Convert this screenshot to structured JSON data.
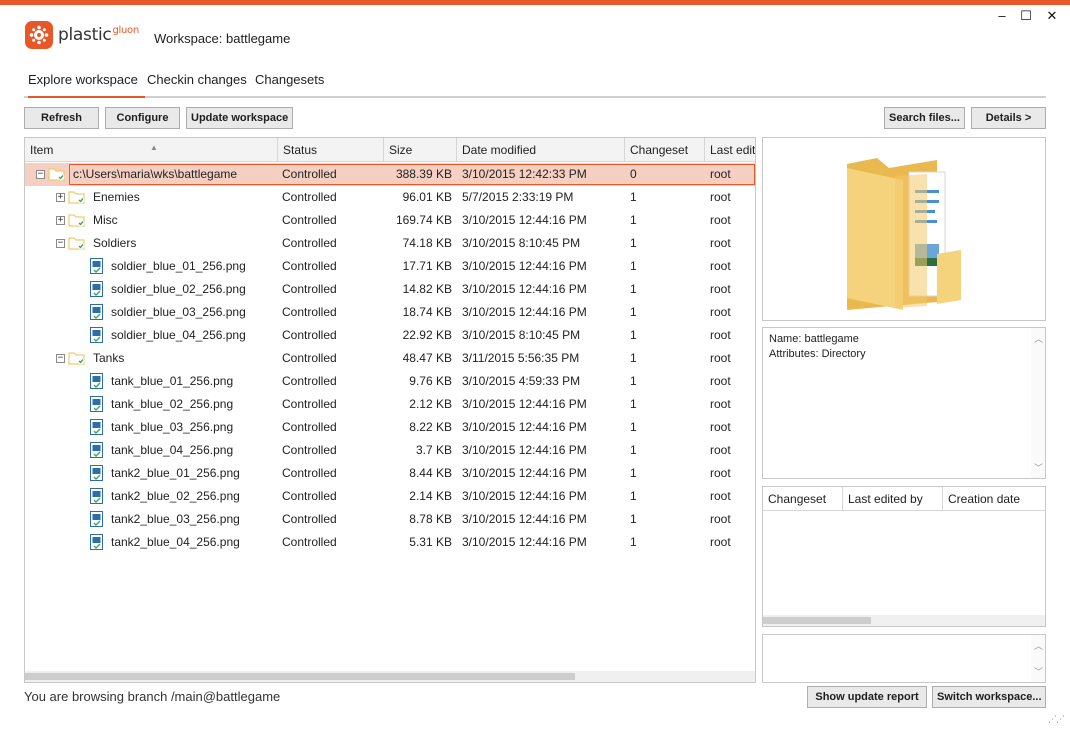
{
  "window": {
    "minimize": "–",
    "maximize": "☐",
    "close": "✕"
  },
  "logo": {
    "name": "plastic",
    "sup": "gluon"
  },
  "header": {
    "title": "Workspace: battlegame"
  },
  "tabs": [
    {
      "label": "Explore workspace",
      "active": true
    },
    {
      "label": "Checkin changes",
      "active": false
    },
    {
      "label": "Changesets",
      "active": false
    }
  ],
  "toolbar": {
    "refresh": "Refresh",
    "configure": "Configure",
    "update_workspace": "Update workspace",
    "search_files": "Search files...",
    "details": "Details >"
  },
  "columns": {
    "item": "Item",
    "status": "Status",
    "size": "Size",
    "date_modified": "Date modified",
    "changeset": "Changeset",
    "last_edit": "Last edit"
  },
  "rows": [
    {
      "name": "c:\\Users\\maria\\wks\\battlegame",
      "type": "folder",
      "level": 0,
      "expander": "−",
      "status": "Controlled",
      "size": "388.39 KB",
      "date": "3/10/2015 12:42:33 PM",
      "changeset": "0",
      "last": "root"
    },
    {
      "name": "Enemies",
      "type": "folder",
      "level": 1,
      "expander": "+",
      "status": "Controlled",
      "size": "96.01 KB",
      "date": "5/7/2015 2:33:19 PM",
      "changeset": "1",
      "last": "root"
    },
    {
      "name": "Misc",
      "type": "folder",
      "level": 1,
      "expander": "+",
      "status": "Controlled",
      "size": "169.74 KB",
      "date": "3/10/2015 12:44:16 PM",
      "changeset": "1",
      "last": "root"
    },
    {
      "name": "Soldiers",
      "type": "folder",
      "level": 1,
      "expander": "−",
      "status": "Controlled",
      "size": "74.18 KB",
      "date": "3/10/2015 8:10:45 PM",
      "changeset": "1",
      "last": "root"
    },
    {
      "name": "soldier_blue_01_256.png",
      "type": "file",
      "level": 2,
      "status": "Controlled",
      "size": "17.71 KB",
      "date": "3/10/2015 12:44:16 PM",
      "changeset": "1",
      "last": "root"
    },
    {
      "name": "soldier_blue_02_256.png",
      "type": "file",
      "level": 2,
      "status": "Controlled",
      "size": "14.82 KB",
      "date": "3/10/2015 12:44:16 PM",
      "changeset": "1",
      "last": "root"
    },
    {
      "name": "soldier_blue_03_256.png",
      "type": "file",
      "level": 2,
      "status": "Controlled",
      "size": "18.74 KB",
      "date": "3/10/2015 12:44:16 PM",
      "changeset": "1",
      "last": "root"
    },
    {
      "name": "soldier_blue_04_256.png",
      "type": "file",
      "level": 2,
      "status": "Controlled",
      "size": "22.92 KB",
      "date": "3/10/2015 8:10:45 PM",
      "changeset": "1",
      "last": "root"
    },
    {
      "name": "Tanks",
      "type": "folder",
      "level": 1,
      "expander": "−",
      "status": "Controlled",
      "size": "48.47 KB",
      "date": "3/11/2015 5:56:35 PM",
      "changeset": "1",
      "last": "root"
    },
    {
      "name": "tank_blue_01_256.png",
      "type": "file",
      "level": 2,
      "status": "Controlled",
      "size": "9.76 KB",
      "date": "3/10/2015 4:59:33 PM",
      "changeset": "1",
      "last": "root"
    },
    {
      "name": "tank_blue_02_256.png",
      "type": "file",
      "level": 2,
      "status": "Controlled",
      "size": "2.12 KB",
      "date": "3/10/2015 12:44:16 PM",
      "changeset": "1",
      "last": "root"
    },
    {
      "name": "tank_blue_03_256.png",
      "type": "file",
      "level": 2,
      "status": "Controlled",
      "size": "8.22 KB",
      "date": "3/10/2015 12:44:16 PM",
      "changeset": "1",
      "last": "root"
    },
    {
      "name": "tank_blue_04_256.png",
      "type": "file",
      "level": 2,
      "status": "Controlled",
      "size": "3.7 KB",
      "date": "3/10/2015 12:44:16 PM",
      "changeset": "1",
      "last": "root"
    },
    {
      "name": "tank2_blue_01_256.png",
      "type": "file",
      "level": 2,
      "status": "Controlled",
      "size": "8.44 KB",
      "date": "3/10/2015 12:44:16 PM",
      "changeset": "1",
      "last": "root"
    },
    {
      "name": "tank2_blue_02_256.png",
      "type": "file",
      "level": 2,
      "status": "Controlled",
      "size": "2.14 KB",
      "date": "3/10/2015 12:44:16 PM",
      "changeset": "1",
      "last": "root"
    },
    {
      "name": "tank2_blue_03_256.png",
      "type": "file",
      "level": 2,
      "status": "Controlled",
      "size": "8.78 KB",
      "date": "3/10/2015 12:44:16 PM",
      "changeset": "1",
      "last": "root"
    },
    {
      "name": "tank2_blue_04_256.png",
      "type": "file",
      "level": 2,
      "status": "Controlled",
      "size": "5.31 KB",
      "date": "3/10/2015 12:44:16 PM",
      "changeset": "1",
      "last": "root"
    }
  ],
  "selected_row": 0,
  "properties": {
    "name": "Name: battlegame",
    "attributes": "Attributes: Directory"
  },
  "history": {
    "changeset": "Changeset",
    "last_edited_by": "Last edited by",
    "creation_date": "Creation date"
  },
  "footer": {
    "status": "You are browsing branch /main@battlegame",
    "show_update_report": "Show update report",
    "switch_workspace": "Switch workspace..."
  },
  "colors": {
    "accent": "#e8572a",
    "selection": "#f6cfc3",
    "folder": "#f3c969",
    "file_icon": "#2d6ea8",
    "check": "#3aa66b"
  },
  "icons": {
    "folder": "controlled-folder-icon",
    "file": "controlled-image-file-icon",
    "preview": "large-folder-icon"
  }
}
